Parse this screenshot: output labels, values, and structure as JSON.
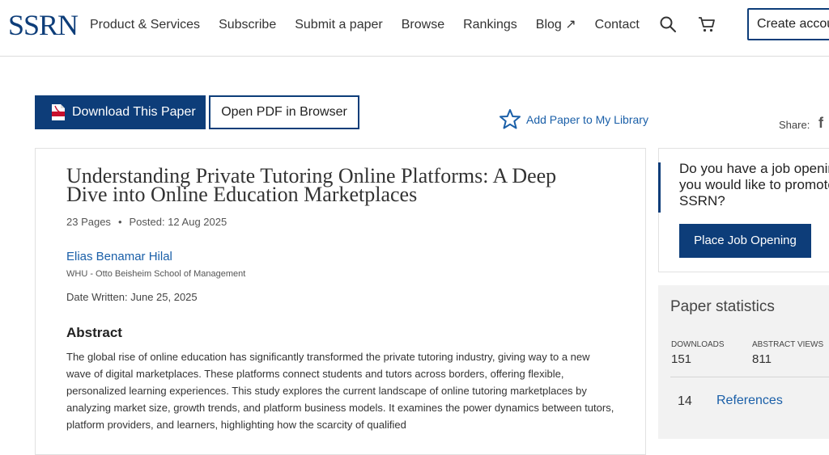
{
  "header": {
    "logo": "SSRN",
    "nav": [
      "Product & Services",
      "Subscribe",
      "Submit a paper",
      "Browse",
      "Rankings",
      "Blog ↗",
      "Contact"
    ],
    "search_icon": "search-icon",
    "cart_icon": "cart-icon",
    "create_account_label": "Create account"
  },
  "actions": {
    "download_label": "Download This Paper",
    "open_pdf_label": "Open PDF in Browser",
    "add_library_label": "Add Paper to My Library",
    "share_label": "Share:",
    "share_facebook": "f"
  },
  "paper": {
    "title": "Understanding Private Tutoring Online Platforms: A Deep Dive into Online Education Marketplaces",
    "pages": "23 Pages",
    "posted": "Posted: 12 Aug 2025",
    "author": "Elias Benamar Hilal",
    "affiliation": "WHU - Otto Beisheim School of Management",
    "date_written": "Date Written: June 25, 2025",
    "abstract_heading": "Abstract",
    "abstract": "The global rise of online education has significantly transformed the private tutoring industry, giving way to a new wave of digital marketplaces. These platforms connect students and tutors across borders, offering flexible, personalized learning experiences. This study explores the current landscape of online tutoring marketplaces by analyzing market size, growth trends, and platform business models. It examines the power dynamics between tutors, platform providers, and learners, highlighting how the scarcity of qualified"
  },
  "job": {
    "text": "Do you have a job opening that\nyou would like to promote on\nSSRN?",
    "button_label": "Place Job Opening"
  },
  "stats": {
    "title": "Paper statistics",
    "downloads_label": "DOWNLOADS",
    "downloads_value": "151",
    "views_label": "ABSTRACT VIEWS",
    "views_value": "811",
    "references_count": "14",
    "references_label": "References"
  },
  "colors": {
    "brand": "#0d3d79",
    "link": "#1a5fa8"
  }
}
